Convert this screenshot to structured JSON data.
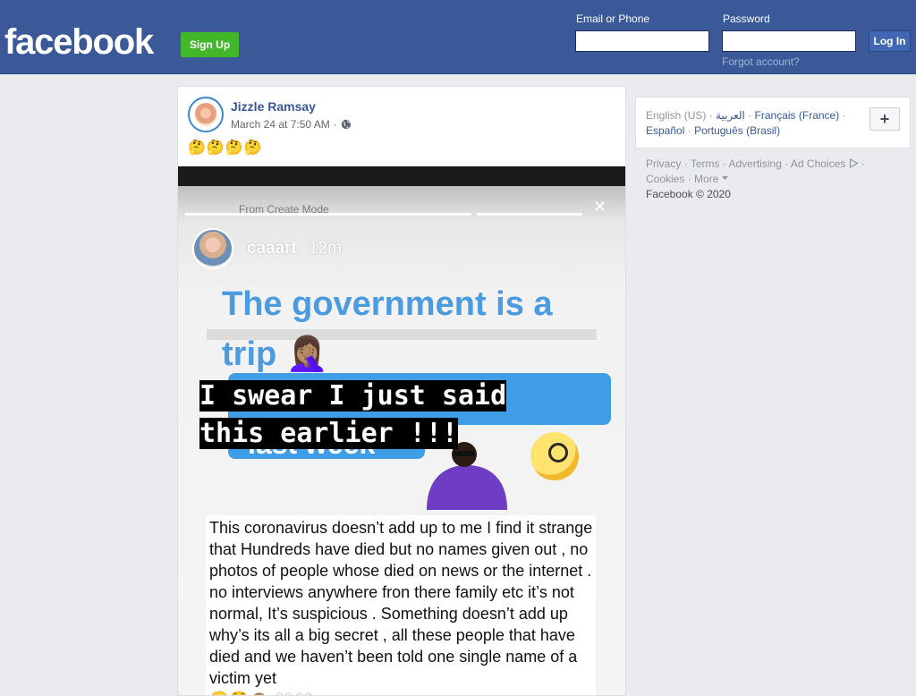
{
  "header": {
    "logo": "facebook",
    "signup_label": "Sign Up",
    "email_label": "Email or Phone",
    "email_value": "",
    "password_label": "Password",
    "password_value": "",
    "login_label": "Log In",
    "forgot_label": "Forgot account?"
  },
  "post": {
    "author": "Jizzle Ramsay",
    "timestamp": "March 24 at 7:50 AM",
    "separator": "·",
    "audience_icon": "globe-icon",
    "text": "🤔🤔🤔🤔",
    "image": {
      "ghost_caption": "From Create Mode",
      "story_user": "caaart",
      "story_time": "12m",
      "headline": "The government is a trip 🤦🏽‍♀️",
      "ghost_overlay": "last week",
      "overlay_lines": [
        "I swear I just said",
        "this earlier !!!"
      ],
      "reaction_icon": "face-with-monocle-icon",
      "body_text": "This coronavirus doesn’t add up to me I find it strange that Hundreds have died but no names given out , no photos of people whose died on news or the internet . no interviews anywhere fron there family etc it’s not normal, It’s suspicious . Something doesn’t add up why’s its all a big secret , all these people that have died and we haven’t been told one single name of a victim yet",
      "body_emoji": "🙄😳🙈 👀👀"
    }
  },
  "sidebar": {
    "languages": [
      "English (US)",
      "العربية",
      "Français (France)",
      "Español",
      "Português (Brasil)"
    ],
    "add_language_label": "+",
    "footer_links": [
      "Privacy",
      "Terms",
      "Advertising",
      "Ad Choices",
      "Cookies",
      "More"
    ],
    "ad_choices_icon": "ad-choices-icon",
    "more_icon": "caret-down-icon",
    "copyright": "Facebook © 2020"
  },
  "colors": {
    "brand_blue": "#3b5998",
    "signup_green": "#42b72a",
    "link_blue": "#385898",
    "page_bg": "#e9ebee"
  }
}
